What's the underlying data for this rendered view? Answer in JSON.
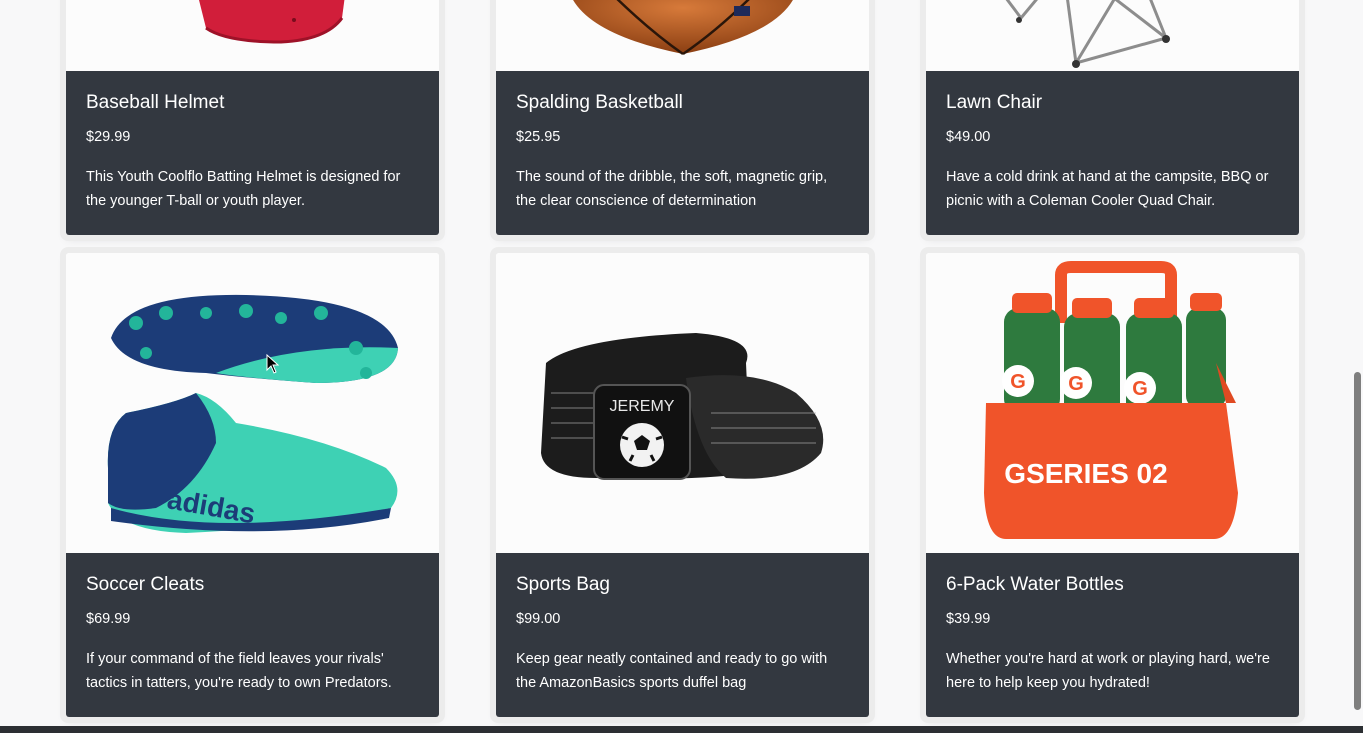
{
  "products": [
    {
      "name": "Baseball Helmet",
      "price": "$29.99",
      "description": "This Youth Coolflo Batting Helmet is designed for the younger T-ball or youth player.",
      "image_icon": "baseball-helmet-image"
    },
    {
      "name": "Spalding Basketball",
      "price": "$25.95",
      "description": "The sound of the dribble, the soft, magnetic grip, the clear conscience of determination",
      "image_icon": "basketball-image"
    },
    {
      "name": "Lawn Chair",
      "price": "$49.00",
      "description": "Have a cold drink at hand at the campsite, BBQ or picnic with a Coleman Cooler Quad Chair.",
      "image_icon": "lawn-chair-image"
    },
    {
      "name": "Soccer Cleats",
      "price": "$69.99",
      "description": "If your command of the field leaves your rivals' tactics in tatters, you're ready to own Predators.",
      "image_icon": "soccer-cleats-image",
      "image_text": "adidas"
    },
    {
      "name": "Sports Bag",
      "price": "$99.00",
      "description": "Keep gear neatly contained and ready to go with the AmazonBasics sports duffel bag",
      "image_icon": "sports-bag-image",
      "image_text": "JEREMY"
    },
    {
      "name": "6-Pack Water Bottles",
      "price": "$39.99",
      "description": "Whether you're hard at work or playing hard, we're here to help keep you hydrated!",
      "image_icon": "water-bottles-image",
      "image_text": "GSERIES 02"
    }
  ],
  "colors": {
    "card_info_bg": "#333840",
    "page_bg": "#f8f8f9"
  }
}
